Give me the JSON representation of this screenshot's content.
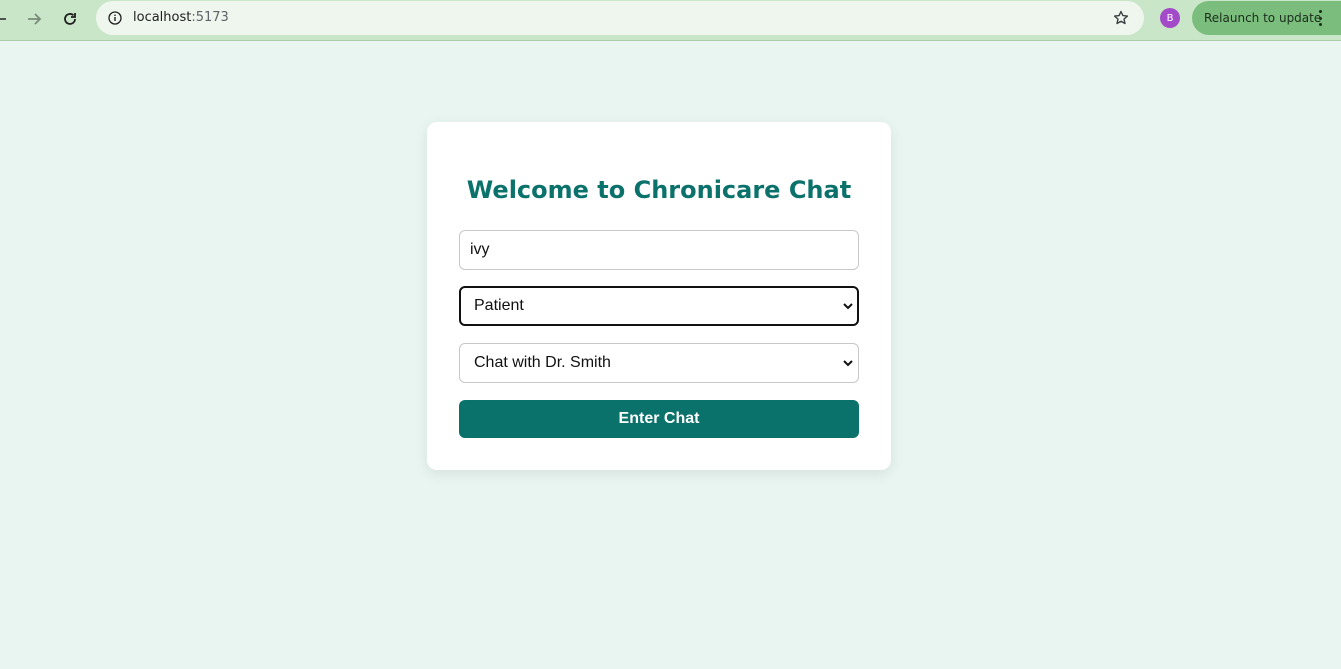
{
  "browser": {
    "url_host": "localhost",
    "url_port": ":5173",
    "profile_initial": "B",
    "relaunch_label": "Relaunch to update",
    "icons": [
      "back-arrow-icon",
      "forward-arrow-icon",
      "reload-icon",
      "site-info-icon",
      "bookmark-star-icon",
      "more-vert-icon"
    ]
  },
  "login": {
    "title": "Welcome to Chronicare Chat",
    "name_value": "ivy",
    "role_selected": "Patient",
    "chat_selected": "Chat with Dr. Smith",
    "enter_label": "Enter Chat"
  },
  "colors": {
    "brand": "#0a716b",
    "page_background": "#e8f5f1",
    "toolbar": "#c9e6c9",
    "relaunch": "#7bbd7d",
    "avatar": "#a24ac8"
  }
}
